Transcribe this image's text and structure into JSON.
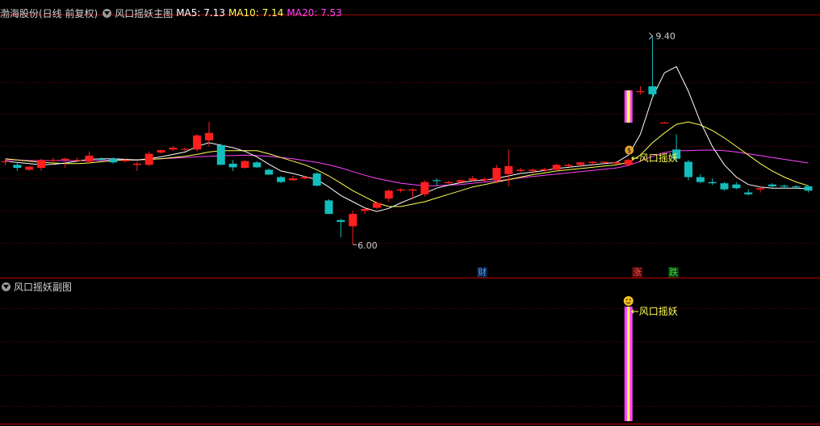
{
  "main_header": {
    "stock": "渤海股份(日线 前复权)",
    "indicator": "风口摇妖主图",
    "ma5_label": "MA5: 7.13",
    "ma10_label": "MA10: 7.14",
    "ma20_label": "MA20: 7.53"
  },
  "sub_header": {
    "indicator": "风口摇妖副图"
  },
  "event_badges": {
    "cai": "财",
    "zhang": "涨",
    "die": "跌"
  },
  "colors": {
    "background": "#000000",
    "up": "#ff1f1f",
    "down": "#14bebe",
    "ma5": "#ffffff",
    "ma10": "#ffff55",
    "ma20": "#ff44ff",
    "grid": "#7a0000",
    "signal_text": "#ffff55",
    "signal_bar": "#ff44ff"
  },
  "chart_data": {
    "type": "candlestick",
    "ylim": [
      5.7,
      9.75
    ],
    "high_label": "9.40",
    "low_label": "6.00",
    "signal_label": "风口摇妖",
    "sub_signal_label": "风口摇妖",
    "signal_index": 52,
    "candles": [
      [
        7.35,
        7.38,
        7.3,
        7.36
      ],
      [
        7.3,
        7.33,
        7.2,
        7.25
      ],
      [
        7.22,
        7.28,
        7.2,
        7.27
      ],
      [
        7.25,
        7.4,
        7.2,
        7.38
      ],
      [
        7.38,
        7.42,
        7.34,
        7.38
      ],
      [
        7.38,
        7.42,
        7.25,
        7.4
      ],
      [
        7.38,
        7.42,
        7.36,
        7.38
      ],
      [
        7.35,
        7.52,
        7.33,
        7.45
      ],
      [
        7.4,
        7.42,
        7.36,
        7.38
      ],
      [
        7.4,
        7.42,
        7.32,
        7.34
      ],
      [
        7.36,
        7.4,
        7.34,
        7.38
      ],
      [
        7.3,
        7.35,
        7.2,
        7.32
      ],
      [
        7.3,
        7.52,
        7.28,
        7.48
      ],
      [
        7.5,
        7.55,
        7.48,
        7.54
      ],
      [
        7.55,
        7.6,
        7.53,
        7.58
      ],
      [
        7.55,
        7.58,
        7.52,
        7.56
      ],
      [
        7.55,
        7.8,
        7.52,
        7.78
      ],
      [
        7.7,
        8.0,
        7.6,
        7.82
      ],
      [
        7.62,
        7.64,
        7.3,
        7.3
      ],
      [
        7.32,
        7.38,
        7.2,
        7.26
      ],
      [
        7.25,
        7.38,
        7.24,
        7.36
      ],
      [
        7.34,
        7.36,
        7.25,
        7.26
      ],
      [
        7.22,
        7.24,
        7.14,
        7.14
      ],
      [
        7.1,
        7.12,
        7.0,
        7.02
      ],
      [
        7.05,
        7.12,
        7.04,
        7.08
      ],
      [
        7.08,
        7.12,
        7.06,
        7.1
      ],
      [
        7.16,
        7.18,
        6.95,
        6.96
      ],
      [
        6.72,
        6.74,
        6.5,
        6.5
      ],
      [
        6.4,
        6.42,
        6.12,
        6.37
      ],
      [
        6.3,
        6.55,
        6.0,
        6.5
      ],
      [
        6.55,
        6.6,
        6.5,
        6.58
      ],
      [
        6.6,
        6.7,
        6.58,
        6.68
      ],
      [
        6.75,
        6.9,
        6.7,
        6.88
      ],
      [
        6.88,
        6.92,
        6.85,
        6.9
      ],
      [
        6.88,
        6.92,
        6.76,
        6.9
      ],
      [
        6.82,
        7.05,
        6.78,
        7.02
      ],
      [
        7.05,
        7.08,
        6.96,
        7.04
      ],
      [
        7.0,
        7.04,
        6.99,
        7.02
      ],
      [
        7.02,
        7.06,
        6.99,
        7.05
      ],
      [
        7.05,
        7.12,
        7.03,
        7.08
      ],
      [
        7.05,
        7.1,
        7.03,
        7.07
      ],
      [
        7.05,
        7.3,
        7.0,
        7.25
      ],
      [
        7.15,
        7.55,
        6.95,
        7.28
      ],
      [
        7.2,
        7.25,
        7.18,
        7.22
      ],
      [
        7.2,
        7.24,
        7.16,
        7.22
      ],
      [
        7.21,
        7.25,
        7.19,
        7.23
      ],
      [
        7.22,
        7.32,
        7.2,
        7.3
      ],
      [
        7.28,
        7.32,
        7.27,
        7.3
      ],
      [
        7.3,
        7.35,
        7.28,
        7.34
      ],
      [
        7.33,
        7.36,
        7.3,
        7.35
      ],
      [
        7.34,
        7.36,
        7.32,
        7.35
      ],
      [
        7.32,
        7.36,
        7.3,
        7.34
      ],
      [
        7.3,
        7.4,
        7.28,
        7.38
      ],
      [
        8.5,
        8.58,
        8.45,
        8.5
      ],
      [
        8.58,
        9.4,
        8.4,
        8.45
      ],
      [
        7.98,
        8.0,
        7.98,
        7.99
      ],
      [
        7.55,
        7.8,
        7.35,
        7.4
      ],
      [
        7.35,
        7.38,
        7.05,
        7.1
      ],
      [
        7.1,
        7.15,
        7.0,
        7.02
      ],
      [
        7.02,
        7.08,
        6.97,
        7.0
      ],
      [
        7.0,
        7.02,
        6.88,
        6.9
      ],
      [
        6.98,
        7.02,
        6.9,
        6.92
      ],
      [
        6.85,
        6.9,
        6.8,
        6.82
      ],
      [
        6.9,
        6.95,
        6.85,
        6.92
      ],
      [
        6.98,
        7.0,
        6.93,
        6.95
      ],
      [
        6.96,
        6.98,
        6.92,
        6.95
      ],
      [
        6.95,
        6.97,
        6.91,
        6.94
      ],
      [
        6.95,
        6.97,
        6.85,
        6.88
      ]
    ],
    "ma5": [
      7.36,
      7.34,
      7.32,
      7.3,
      7.31,
      7.33,
      7.36,
      7.39,
      7.4,
      7.4,
      7.39,
      7.38,
      7.4,
      7.43,
      7.47,
      7.51,
      7.6,
      7.66,
      7.62,
      7.58,
      7.52,
      7.43,
      7.31,
      7.2,
      7.16,
      7.11,
      7.06,
      6.94,
      6.8,
      6.7,
      6.6,
      6.54,
      6.59,
      6.68,
      6.76,
      6.84,
      6.92,
      6.97,
      7.01,
      7.04,
      7.05,
      7.08,
      7.12,
      7.16,
      7.18,
      7.21,
      7.24,
      7.26,
      7.28,
      7.3,
      7.32,
      7.34,
      7.46,
      7.8,
      8.4,
      8.8,
      8.9,
      8.5,
      8.0,
      7.6,
      7.3,
      7.1,
      6.98,
      6.94,
      6.92,
      6.92,
      6.92,
      6.91
    ],
    "ma10": [
      7.4,
      7.38,
      7.36,
      7.34,
      7.33,
      7.32,
      7.32,
      7.33,
      7.35,
      7.37,
      7.38,
      7.38,
      7.39,
      7.4,
      7.42,
      7.44,
      7.47,
      7.51,
      7.53,
      7.53,
      7.53,
      7.53,
      7.48,
      7.42,
      7.36,
      7.3,
      7.22,
      7.12,
      7.0,
      6.88,
      6.78,
      6.68,
      6.62,
      6.62,
      6.66,
      6.7,
      6.76,
      6.82,
      6.88,
      6.94,
      6.98,
      7.02,
      7.06,
      7.1,
      7.14,
      7.17,
      7.2,
      7.22,
      7.24,
      7.26,
      7.28,
      7.3,
      7.34,
      7.46,
      7.66,
      7.82,
      7.96,
      8.0,
      7.95,
      7.86,
      7.74,
      7.6,
      7.46,
      7.32,
      7.2,
      7.1,
      7.02,
      6.96
    ],
    "ma20": [
      7.38,
      7.38,
      7.37,
      7.37,
      7.37,
      7.37,
      7.37,
      7.37,
      7.37,
      7.38,
      7.38,
      7.38,
      7.39,
      7.4,
      7.41,
      7.42,
      7.43,
      7.44,
      7.45,
      7.45,
      7.46,
      7.45,
      7.44,
      7.42,
      7.4,
      7.37,
      7.34,
      7.3,
      7.25,
      7.19,
      7.13,
      7.08,
      7.04,
      7.0,
      6.98,
      6.96,
      6.96,
      6.97,
      6.98,
      7.0,
      7.02,
      7.04,
      7.06,
      7.09,
      7.11,
      7.13,
      7.15,
      7.17,
      7.19,
      7.21,
      7.23,
      7.25,
      7.29,
      7.36,
      7.44,
      7.5,
      7.53,
      7.53,
      7.54,
      7.54,
      7.53,
      7.51,
      7.48,
      7.45,
      7.42,
      7.39,
      7.36,
      7.33
    ]
  }
}
